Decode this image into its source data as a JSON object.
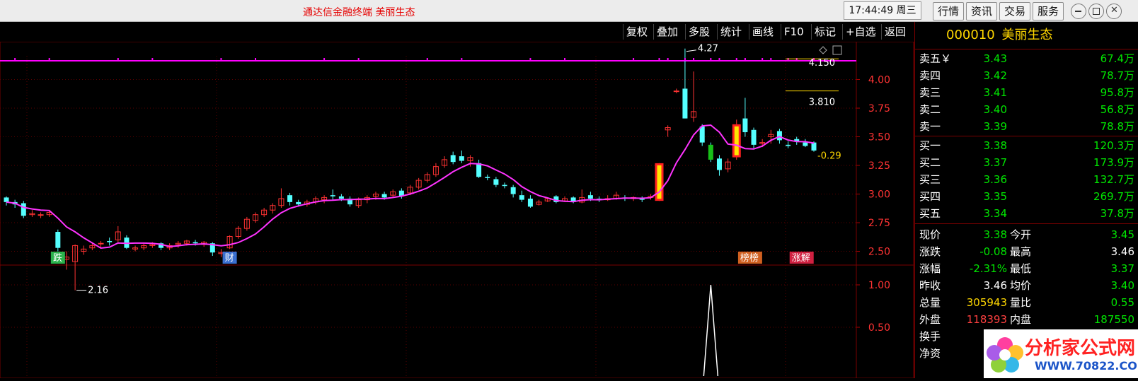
{
  "app": {
    "title": "通达信金融终端    美丽生态",
    "clock": "17:44:49 周三"
  },
  "top_buttons": [
    "行情",
    "资讯",
    "交易",
    "服务"
  ],
  "toolbar": [
    "复权",
    "叠加",
    "多股",
    "统计",
    "画线",
    "F10",
    "标记",
    "+自选",
    "返回"
  ],
  "stock": {
    "code": "000010",
    "name": "美丽生态"
  },
  "order_book": {
    "sell": [
      {
        "label": "卖五",
        "mark": "￥",
        "price": "3.43",
        "vol": "67.4万"
      },
      {
        "label": "卖四",
        "price": "3.42",
        "vol": "78.7万"
      },
      {
        "label": "卖三",
        "price": "3.41",
        "vol": "95.8万"
      },
      {
        "label": "卖二",
        "price": "3.40",
        "vol": "56.8万"
      },
      {
        "label": "卖一",
        "price": "3.39",
        "vol": "78.8万"
      }
    ],
    "buy": [
      {
        "label": "买一",
        "price": "3.38",
        "vol": "120.3万"
      },
      {
        "label": "买二",
        "price": "3.37",
        "vol": "173.9万"
      },
      {
        "label": "买三",
        "price": "3.36",
        "vol": "132.7万"
      },
      {
        "label": "买四",
        "price": "3.35",
        "vol": "269.7万"
      },
      {
        "label": "买五",
        "price": "3.34",
        "vol": "37.8万"
      }
    ]
  },
  "stats": [
    {
      "l1": "现价",
      "v1": "3.38",
      "c1": "green",
      "l2": "今开",
      "v2": "3.45",
      "c2": "green"
    },
    {
      "l1": "涨跌",
      "v1": "-0.08",
      "c1": "green",
      "l2": "最高",
      "v2": "3.46",
      "c2": "white"
    },
    {
      "l1": "涨幅",
      "v1": "-2.31%",
      "c1": "green",
      "l2": "最低",
      "v2": "3.37",
      "c2": "green"
    },
    {
      "l1": "昨收",
      "v1": "3.46",
      "c1": "white",
      "l2": "均价",
      "v2": "3.40",
      "c2": "green"
    },
    {
      "l1": "总量",
      "v1": "305943",
      "c1": "yellow",
      "l2": "量比",
      "v2": "0.55",
      "c2": "green"
    },
    {
      "l1": "外盘",
      "v1": "118393",
      "c1": "red",
      "l2": "内盘",
      "v2": "187550",
      "c2": "green"
    },
    {
      "l1": "换手",
      "v1": "",
      "c1": "white",
      "l2": "",
      "v2": "",
      "c2": "white"
    },
    {
      "l1": "净资",
      "v1": "",
      "c1": "white",
      "l2": "",
      "v2": "",
      "c2": "white"
    }
  ],
  "logo": {
    "text": "分析家公式网",
    "url": "WWW.70822.COM"
  },
  "chart_data": {
    "type": "candlestick",
    "price_axis": {
      "ticks": [
        "4.00",
        "3.75",
        "3.50",
        "3.25",
        "3.00",
        "2.75",
        "2.50"
      ],
      "range": [
        2.38,
        4.33
      ]
    },
    "annotations": {
      "high": "4.27",
      "low": "2.16",
      "pct": "-0.29",
      "level1": "4.150",
      "level2": "3.810"
    },
    "event_labels": [
      {
        "text": "跌",
        "idx": 6,
        "color": "#2bb24c"
      },
      {
        "text": "财",
        "idx": 26,
        "color": "#3a6fd0"
      },
      {
        "text": "榜榜",
        "idx": 86,
        "color": "#d06020"
      },
      {
        "text": "涨解",
        "idx": 92,
        "color": "#d02040"
      }
    ],
    "candles": [
      [
        2.97,
        2.93,
        2.98,
        2.9
      ],
      [
        2.93,
        2.91,
        2.95,
        2.88
      ],
      [
        2.92,
        2.81,
        2.94,
        2.79
      ],
      [
        2.82,
        2.83,
        2.86,
        2.8
      ],
      [
        2.82,
        2.82,
        2.84,
        2.79
      ],
      [
        2.82,
        2.84,
        2.86,
        2.8
      ],
      [
        2.67,
        2.53,
        2.69,
        2.5
      ],
      [
        2.43,
        2.45,
        2.5,
        2.34
      ],
      [
        2.41,
        2.55,
        2.56,
        2.16
      ],
      [
        2.5,
        2.52,
        2.55,
        2.47
      ],
      [
        2.53,
        2.55,
        2.58,
        2.51
      ],
      [
        2.57,
        2.57,
        2.59,
        2.53
      ],
      [
        2.59,
        2.58,
        2.62,
        2.55
      ],
      [
        2.6,
        2.67,
        2.72,
        2.58
      ],
      [
        2.62,
        2.53,
        2.64,
        2.52
      ],
      [
        2.52,
        2.53,
        2.55,
        2.5
      ],
      [
        2.53,
        2.55,
        2.57,
        2.51
      ],
      [
        2.55,
        2.56,
        2.58,
        2.53
      ],
      [
        2.57,
        2.53,
        2.58,
        2.51
      ],
      [
        2.53,
        2.55,
        2.57,
        2.51
      ],
      [
        2.56,
        2.57,
        2.59,
        2.53
      ],
      [
        2.57,
        2.59,
        2.6,
        2.55
      ],
      [
        2.58,
        2.57,
        2.6,
        2.55
      ],
      [
        2.56,
        2.58,
        2.59,
        2.54
      ],
      [
        2.57,
        2.49,
        2.58,
        2.46
      ],
      [
        2.48,
        2.49,
        2.52,
        2.45
      ],
      [
        2.53,
        2.63,
        2.64,
        2.52
      ],
      [
        2.63,
        2.7,
        2.72,
        2.61
      ],
      [
        2.7,
        2.78,
        2.8,
        2.68
      ],
      [
        2.77,
        2.82,
        2.84,
        2.75
      ],
      [
        2.82,
        2.86,
        2.88,
        2.8
      ],
      [
        2.86,
        2.9,
        2.92,
        2.83
      ],
      [
        2.9,
        2.96,
        3.05,
        2.88
      ],
      [
        2.99,
        2.93,
        3.01,
        2.9
      ],
      [
        2.93,
        2.91,
        2.95,
        2.89
      ],
      [
        2.91,
        2.93,
        2.95,
        2.89
      ],
      [
        2.93,
        2.96,
        2.98,
        2.91
      ],
      [
        2.95,
        2.97,
        2.99,
        2.92
      ],
      [
        2.99,
        2.98,
        3.04,
        2.95
      ],
      [
        2.98,
        2.96,
        3.0,
        2.94
      ],
      [
        2.96,
        2.91,
        2.98,
        2.89
      ],
      [
        2.9,
        2.95,
        2.97,
        2.88
      ],
      [
        2.95,
        2.97,
        2.99,
        2.92
      ],
      [
        2.98,
        3.0,
        3.02,
        2.95
      ],
      [
        3.0,
        2.97,
        3.02,
        2.95
      ],
      [
        2.99,
        3.02,
        3.04,
        2.97
      ],
      [
        3.03,
        2.98,
        3.05,
        2.96
      ],
      [
        3.01,
        3.06,
        3.08,
        2.99
      ],
      [
        3.06,
        3.12,
        3.14,
        3.04
      ],
      [
        3.12,
        3.17,
        3.19,
        3.1
      ],
      [
        3.17,
        3.24,
        3.27,
        3.15
      ],
      [
        3.25,
        3.3,
        3.33,
        3.23
      ],
      [
        3.34,
        3.28,
        3.37,
        3.26
      ],
      [
        3.33,
        3.29,
        3.38,
        3.27
      ],
      [
        3.29,
        3.32,
        3.34,
        3.24
      ],
      [
        3.27,
        3.15,
        3.3,
        3.14
      ],
      [
        3.15,
        3.14,
        3.17,
        3.12
      ],
      [
        3.13,
        3.08,
        3.15,
        3.06
      ],
      [
        3.08,
        3.07,
        3.1,
        3.05
      ],
      [
        3.06,
        3.0,
        3.08,
        2.97
      ],
      [
        2.99,
        2.95,
        3.03,
        2.93
      ],
      [
        2.96,
        2.89,
        2.99,
        2.88
      ],
      [
        2.91,
        2.93,
        2.95,
        2.9
      ],
      [
        2.94,
        2.96,
        2.97,
        2.93
      ],
      [
        2.98,
        2.93,
        2.99,
        2.92
      ],
      [
        2.94,
        2.96,
        2.98,
        2.93
      ],
      [
        2.97,
        2.93,
        2.98,
        2.92
      ],
      [
        2.93,
        2.97,
        3.04,
        2.92
      ],
      [
        2.99,
        2.96,
        3.02,
        2.94
      ],
      [
        2.96,
        2.95,
        2.98,
        2.93
      ],
      [
        2.95,
        2.96,
        2.99,
        2.94
      ],
      [
        2.96,
        2.99,
        3.02,
        2.95
      ],
      [
        2.97,
        2.96,
        2.99,
        2.94
      ],
      [
        2.96,
        2.97,
        2.98,
        2.94
      ],
      [
        2.96,
        2.95,
        2.98,
        2.93
      ],
      [
        2.97,
        2.98,
        3.0,
        2.95
      ],
      [
        2.95,
        3.26,
        3.27,
        2.94
      ],
      [
        3.56,
        3.58,
        3.6,
        3.5
      ],
      [
        3.9,
        3.9,
        3.92,
        3.88
      ],
      [
        3.92,
        3.66,
        4.27,
        3.66
      ],
      [
        3.67,
        3.72,
        4.07,
        3.63
      ],
      [
        3.59,
        3.45,
        3.61,
        3.42
      ],
      [
        3.43,
        3.3,
        3.45,
        3.28
      ],
      [
        3.31,
        3.21,
        3.34,
        3.16
      ],
      [
        3.22,
        3.28,
        3.31,
        3.19
      ],
      [
        3.33,
        3.6,
        3.65,
        3.3
      ],
      [
        3.66,
        3.54,
        3.84,
        3.5
      ],
      [
        3.56,
        3.43,
        3.58,
        3.4
      ],
      [
        3.44,
        3.45,
        3.48,
        3.41
      ],
      [
        3.5,
        3.52,
        3.56,
        3.44
      ],
      [
        3.55,
        3.47,
        3.57,
        3.44
      ],
      [
        3.43,
        3.42,
        3.46,
        3.4
      ],
      [
        3.48,
        3.46,
        3.5,
        3.43
      ],
      [
        3.45,
        3.42,
        3.48,
        3.41
      ],
      [
        3.45,
        3.38,
        3.46,
        3.37
      ]
    ],
    "volume_indicator": {
      "ticks": [
        "1.00",
        "0.50"
      ],
      "spike_index": 82
    }
  }
}
